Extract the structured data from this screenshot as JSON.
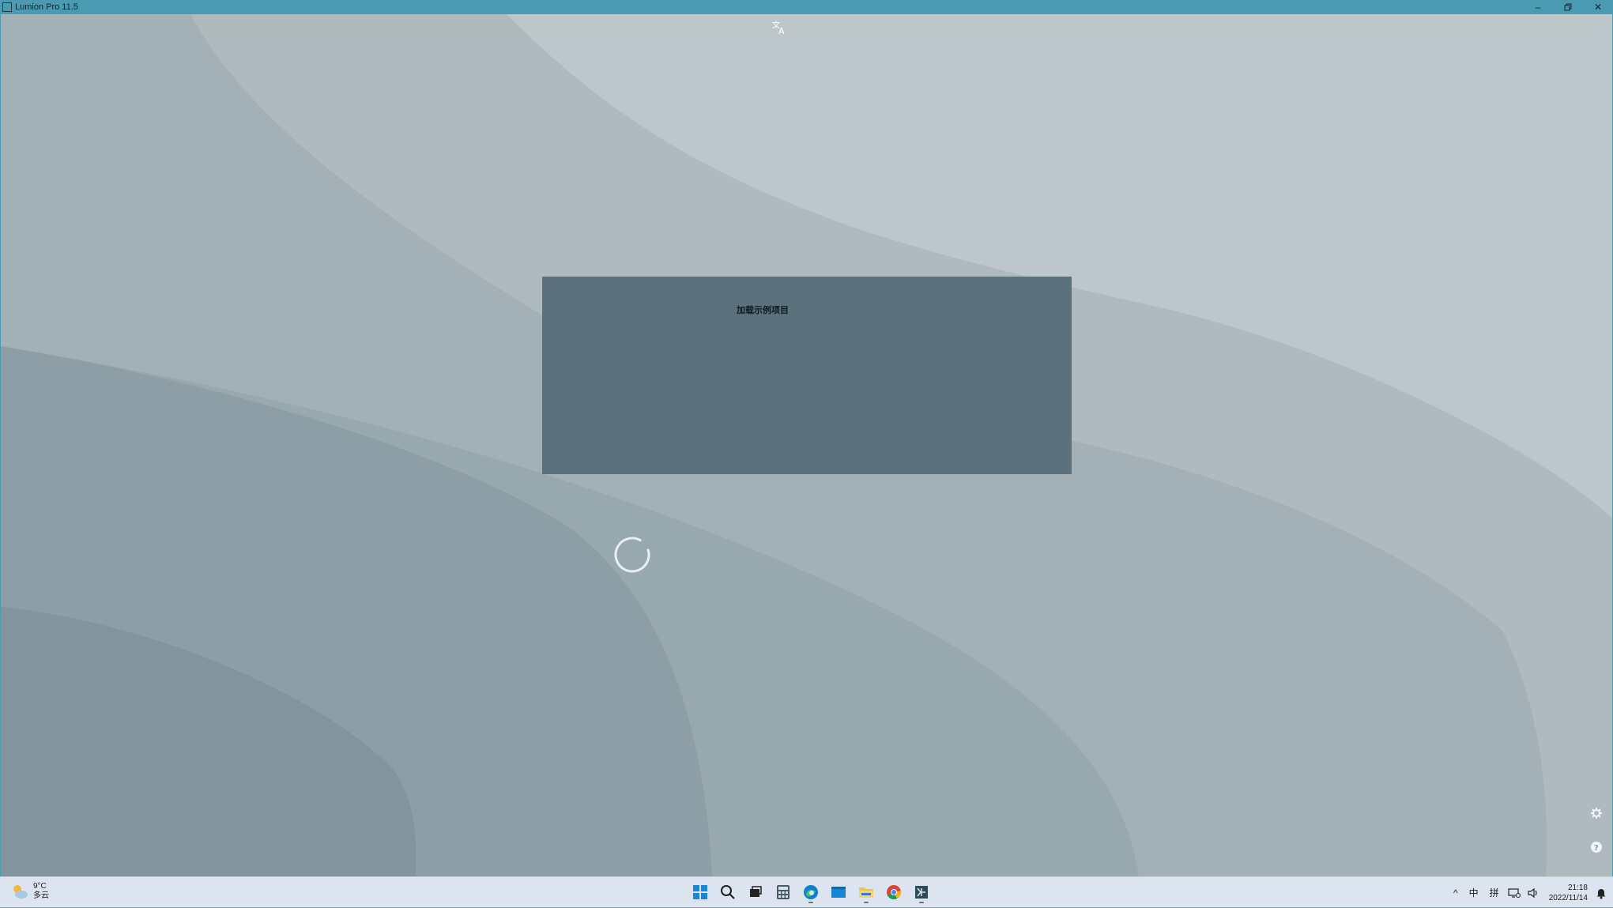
{
  "window": {
    "title": "Lumion Pro 11.5"
  },
  "dialog": {
    "title": "加载示例项目"
  },
  "taskbar": {
    "weather": {
      "temp": "9°C",
      "condition": "多云"
    },
    "tray": {
      "chevron": "^",
      "ime_lang": "中",
      "ime_mode": "拼"
    },
    "clock": {
      "time": "21:18",
      "date": "2022/11/14"
    }
  },
  "colors": {
    "titlebar": "#4a9bb2",
    "dialog": "#5b727d",
    "taskbar": "#dbe4ef"
  }
}
